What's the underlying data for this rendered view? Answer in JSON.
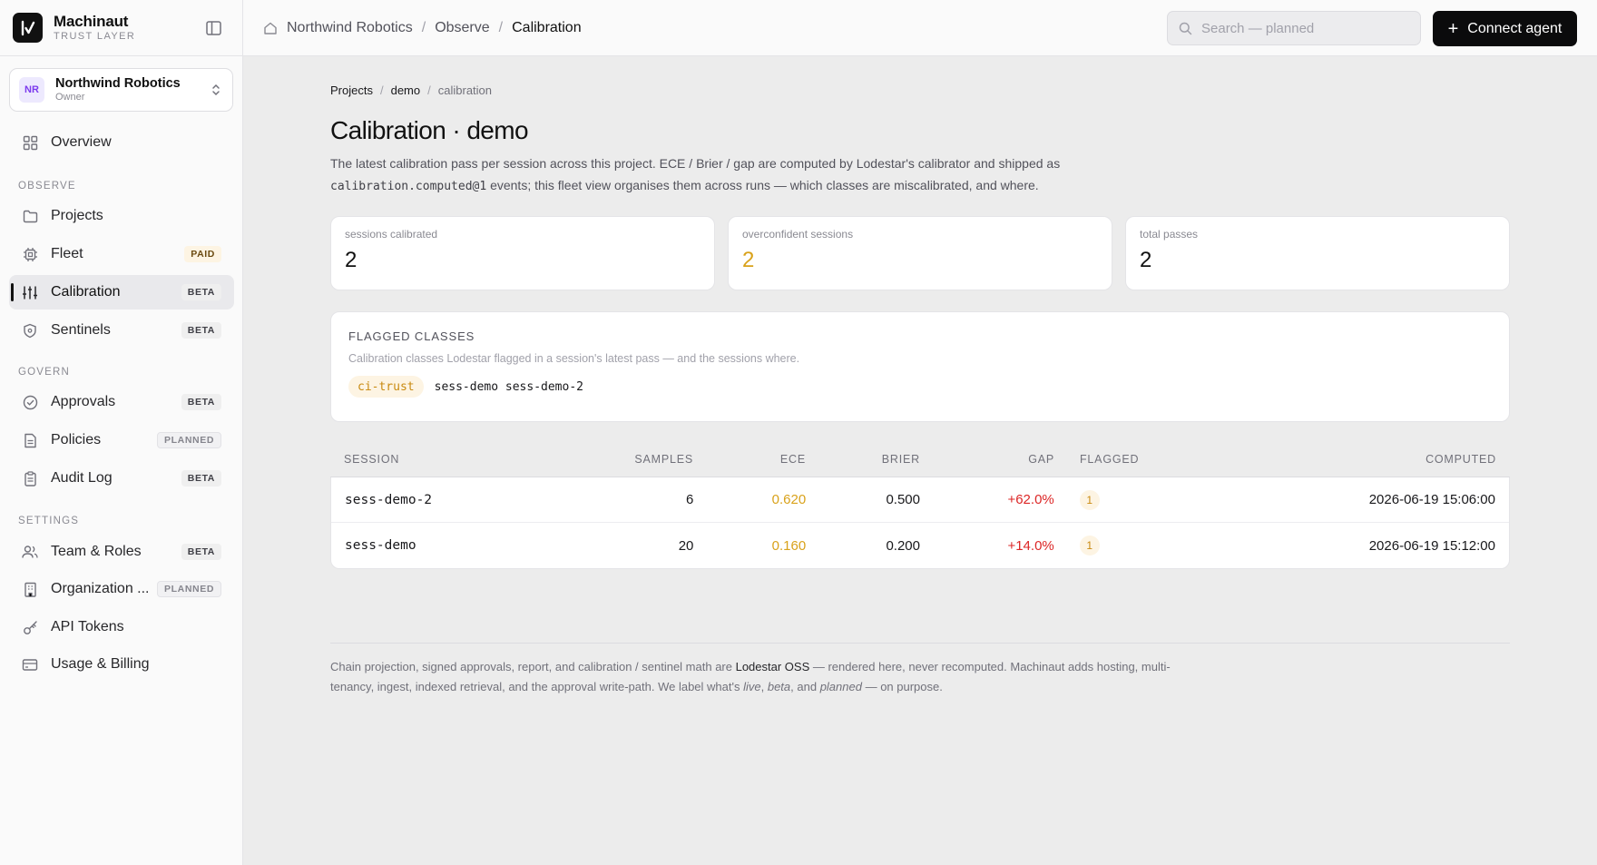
{
  "brand": {
    "name": "Machinaut",
    "subtitle": "TRUST LAYER",
    "logo_glyph": "I/"
  },
  "org": {
    "initials": "NR",
    "name": "Northwind Robotics",
    "role": "Owner"
  },
  "sidebar": {
    "overview": {
      "label": "Overview",
      "icon": "grid-icon"
    },
    "sections": {
      "observe": "OBSERVE",
      "govern": "GOVERN",
      "settings": "SETTINGS"
    },
    "items": [
      {
        "label": "Projects",
        "badge": "",
        "icon": "folder-icon"
      },
      {
        "label": "Fleet",
        "badge": "PAID",
        "icon": "cpu-icon"
      },
      {
        "label": "Calibration",
        "badge": "BETA",
        "icon": "sliders-icon",
        "active": true
      },
      {
        "label": "Sentinels",
        "badge": "BETA",
        "icon": "shield-icon"
      },
      {
        "label": "Approvals",
        "badge": "BETA",
        "icon": "check-circle-icon"
      },
      {
        "label": "Policies",
        "badge": "PLANNED",
        "icon": "document-icon"
      },
      {
        "label": "Audit Log",
        "badge": "BETA",
        "icon": "clipboard-icon"
      },
      {
        "label": "Team & Roles",
        "badge": "BETA",
        "icon": "users-icon"
      },
      {
        "label": "Organization ...",
        "badge": "PLANNED",
        "icon": "building-icon"
      },
      {
        "label": "API Tokens",
        "badge": "",
        "icon": "key-icon"
      },
      {
        "label": "Usage & Billing",
        "badge": "",
        "icon": "credit-card-icon"
      }
    ]
  },
  "topbar": {
    "breadcrumb": [
      "Northwind Robotics",
      "Observe",
      "Calibration"
    ],
    "breadcrumb_sep": "/",
    "search_placeholder": "Search — planned",
    "connect_label": "Connect agent"
  },
  "page": {
    "crumbs": [
      "Projects",
      "demo",
      "calibration"
    ],
    "crumb_sep": "/",
    "title": "Calibration · demo",
    "desc_part1": "The latest calibration pass per session across this project. ECE / Brier / gap are computed by Lodestar's calibrator and shipped as",
    "desc_code": "calibration.computed@1",
    "desc_part2": " events; this fleet view organises them across runs — which classes are miscalibrated, and where."
  },
  "stats": [
    {
      "label": "sessions calibrated",
      "value": "2"
    },
    {
      "label": "overconfident sessions",
      "value": "2"
    },
    {
      "label": "total passes",
      "value": "2"
    }
  ],
  "flagged": {
    "title": "FLAGGED CLASSES",
    "subtitle": "Calibration classes Lodestar flagged in a session's latest pass — and the sessions where.",
    "class_name": "ci-trust",
    "sessions": "sess-demo sess-demo-2"
  },
  "table": {
    "headers": {
      "session": "SESSION",
      "samples": "SAMPLES",
      "ece": "ECE",
      "brier": "BRIER",
      "gap": "GAP",
      "flagged": "FLAGGED",
      "computed": "COMPUTED"
    },
    "rows": [
      {
        "session": "sess-demo-2",
        "samples": "6",
        "ece": "0.620",
        "brier": "0.500",
        "gap": "+62.0%",
        "flagged": "1",
        "computed": "2026-06-19 15:06:00"
      },
      {
        "session": "sess-demo",
        "samples": "20",
        "ece": "0.160",
        "brier": "0.200",
        "gap": "+14.0%",
        "flagged": "1",
        "computed": "2026-06-19 15:12:00"
      }
    ]
  },
  "footer": {
    "t1": "Chain projection, signed approvals, report, and calibration / sentinel math are ",
    "oss": "Lodestar OSS",
    "t2": " — rendered here, never recomputed. Machinaut adds hosting, multi-tenancy, ingest, indexed retrieval, and the approval write-path. We label what's ",
    "live": "live",
    "c1": ", ",
    "beta": "beta",
    "c2": ", and ",
    "planned": "planned",
    "t3": " — on purpose."
  },
  "colors": {
    "accent_warn": "#d9a21b",
    "danger": "#dc2626",
    "primary_button": "#0b0b0c"
  }
}
